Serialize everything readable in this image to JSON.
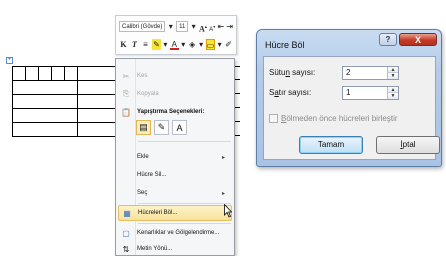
{
  "mini_toolbar": {
    "font_name": "Calibri (Gövde)",
    "font_size": "11",
    "bold_label": "K",
    "italic_label": "T"
  },
  "context_menu": {
    "items": [
      {
        "label": "Kes",
        "icon": "scissors-icon",
        "disabled": true
      },
      {
        "label": "Kopyala",
        "icon": "copy-icon",
        "disabled": true
      },
      {
        "label": "Yapıştırma Seçenekleri:",
        "icon": "paste-icon",
        "bold": true
      },
      {
        "label": "Ekle",
        "submenu": true
      },
      {
        "label": "Hücre Sil..."
      },
      {
        "label": "Seç",
        "submenu": true
      },
      {
        "label": "Hücreleri Böl...",
        "icon": "split-cells-icon",
        "highlighted": true
      },
      {
        "label": "Kenarlıklar ve Gölgelendirme...",
        "icon": "borders-icon"
      },
      {
        "label": "Metin Yönü...",
        "icon": "text-direction-icon"
      }
    ]
  },
  "dialog": {
    "title": "Hücre Böl",
    "help_label": "?",
    "close_label": "X",
    "columns_label_pre": "Sütu",
    "columns_label_u": "n",
    "columns_label_post": " sayısı:",
    "columns_value": "2",
    "rows_label_pre": "S",
    "rows_label_u": "a",
    "rows_label_post": "tır sayısı:",
    "rows_value": "1",
    "merge_label_pre": "",
    "merge_label_u": "B",
    "merge_label_post": "ölmeden önce hücreleri birleştir",
    "merge_checked": false,
    "ok_label": "Tamam",
    "cancel_label_pre": "",
    "cancel_label_u": "İ",
    "cancel_label_post": "ptal"
  },
  "colors": {
    "highlight": "#fdf3c9",
    "close_button": "#c43c26",
    "dialog_frame": "#b4cbe8"
  }
}
